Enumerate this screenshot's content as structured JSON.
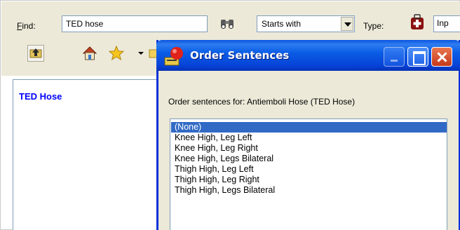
{
  "search": {
    "find_label_underlined": "F",
    "find_label_rest": "ind:",
    "find_value": "TED hose",
    "match_mode": "Starts with",
    "type_label": "Type:",
    "type_value": "Inp"
  },
  "icons": {
    "binoculars": "binoculars-icon",
    "type": "medical-kit-icon",
    "up_folder": "up-folder-icon",
    "home": "home-icon",
    "favorites": "star-icon",
    "folder": "folder-icon"
  },
  "results": {
    "items": [
      "TED Hose"
    ]
  },
  "dialog": {
    "title": "Order Sentences",
    "label": "Order sentences for:  Antiemboli Hose (TED Hose)",
    "selected_index": 0,
    "items": [
      "(None)",
      "Knee High, Leg Left",
      "Knee High, Leg Right",
      "Knee High, Legs Bilateral",
      "Thigh High, Leg Left",
      "Thigh High, Leg Right",
      "Thigh High, Legs Bilateral"
    ]
  },
  "colors": {
    "titlebar": "#0b5ee6",
    "selection": "#316ac5",
    "result_link": "#0000ff",
    "close_button": "#c6391a"
  }
}
